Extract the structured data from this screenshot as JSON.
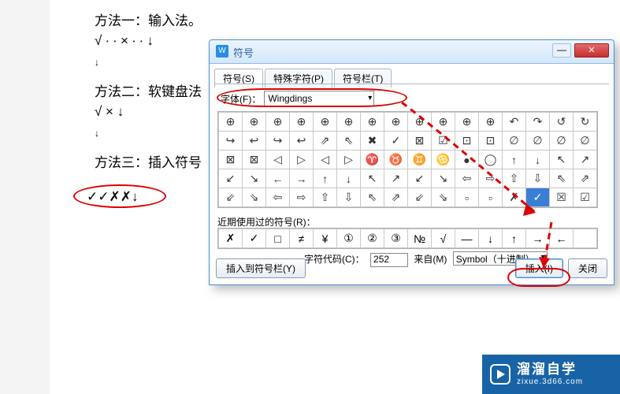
{
  "doc": {
    "l1": "方法一：输入法。",
    "l2": "√ ∙ ∙ × ∙ ∙ ↓",
    "l3": "↓",
    "l4": "方法二：软键盘法",
    "l5": "√ × ↓",
    "l6": "↓",
    "l7": "方法三：插入符号",
    "result": "✓✓✗✗↓"
  },
  "dialog": {
    "title": "符号",
    "tabs": [
      "符号(S)",
      "特殊字符(P)",
      "符号栏(T)"
    ],
    "font_label": "字体(F)：",
    "font_value": "Wingdings",
    "recent_label": "近期使用过的符号(R)：",
    "code_label": "字符代码(C)：",
    "code_value": "252",
    "from_label": "来自(M)",
    "from_value": "Symbol（十进制）",
    "btn_toolbar": "插入到符号栏(Y)",
    "btn_insert": "插入(I)",
    "btn_close": "关闭"
  },
  "grid": [
    [
      "⊕",
      "⊕",
      "⊕",
      "⊕",
      "⊕",
      "⊕",
      "⊕",
      "⊕",
      "⊕",
      "⊕",
      "⊕",
      "⊕",
      "↶",
      "↷",
      "↺",
      "↻"
    ],
    [
      "↪",
      "↩",
      "↪",
      "↩",
      "⇗",
      "⇖",
      "✖",
      "✓",
      "⊠",
      "☑",
      "⊡",
      "⊡",
      "∅",
      "∅",
      "∅",
      "∅"
    ],
    [
      "⊠",
      "⊠",
      "◁",
      "▷",
      "◁",
      "▷",
      "♈",
      "♉",
      "♊",
      "♋",
      "●",
      "◯",
      "↑",
      "↓",
      "↖",
      "↗"
    ],
    [
      "↙",
      "↘",
      "←",
      "→",
      "↑",
      "↓",
      "↖",
      "↗",
      "↙",
      "↘",
      "⇦",
      "⇨",
      "⇧",
      "⇩",
      "⇖",
      "⇗"
    ],
    [
      "⇙",
      "⇘",
      "⇦",
      "⇨",
      "⇧",
      "⇩",
      "⇖",
      "⇗",
      "⇙",
      "⇘",
      "▫",
      "▫",
      "✗",
      "✓",
      "☒",
      "☑"
    ]
  ],
  "grid_selected": {
    "row": 4,
    "col": 13
  },
  "recent": [
    "✗",
    "✓",
    "□",
    "≠",
    "¥",
    "①",
    "②",
    "③",
    "№",
    "√",
    "—",
    "↓",
    "↑",
    "→",
    "←",
    ""
  ],
  "watermark": {
    "big": "溜溜自学",
    "small": "zixue.3d66.com"
  }
}
